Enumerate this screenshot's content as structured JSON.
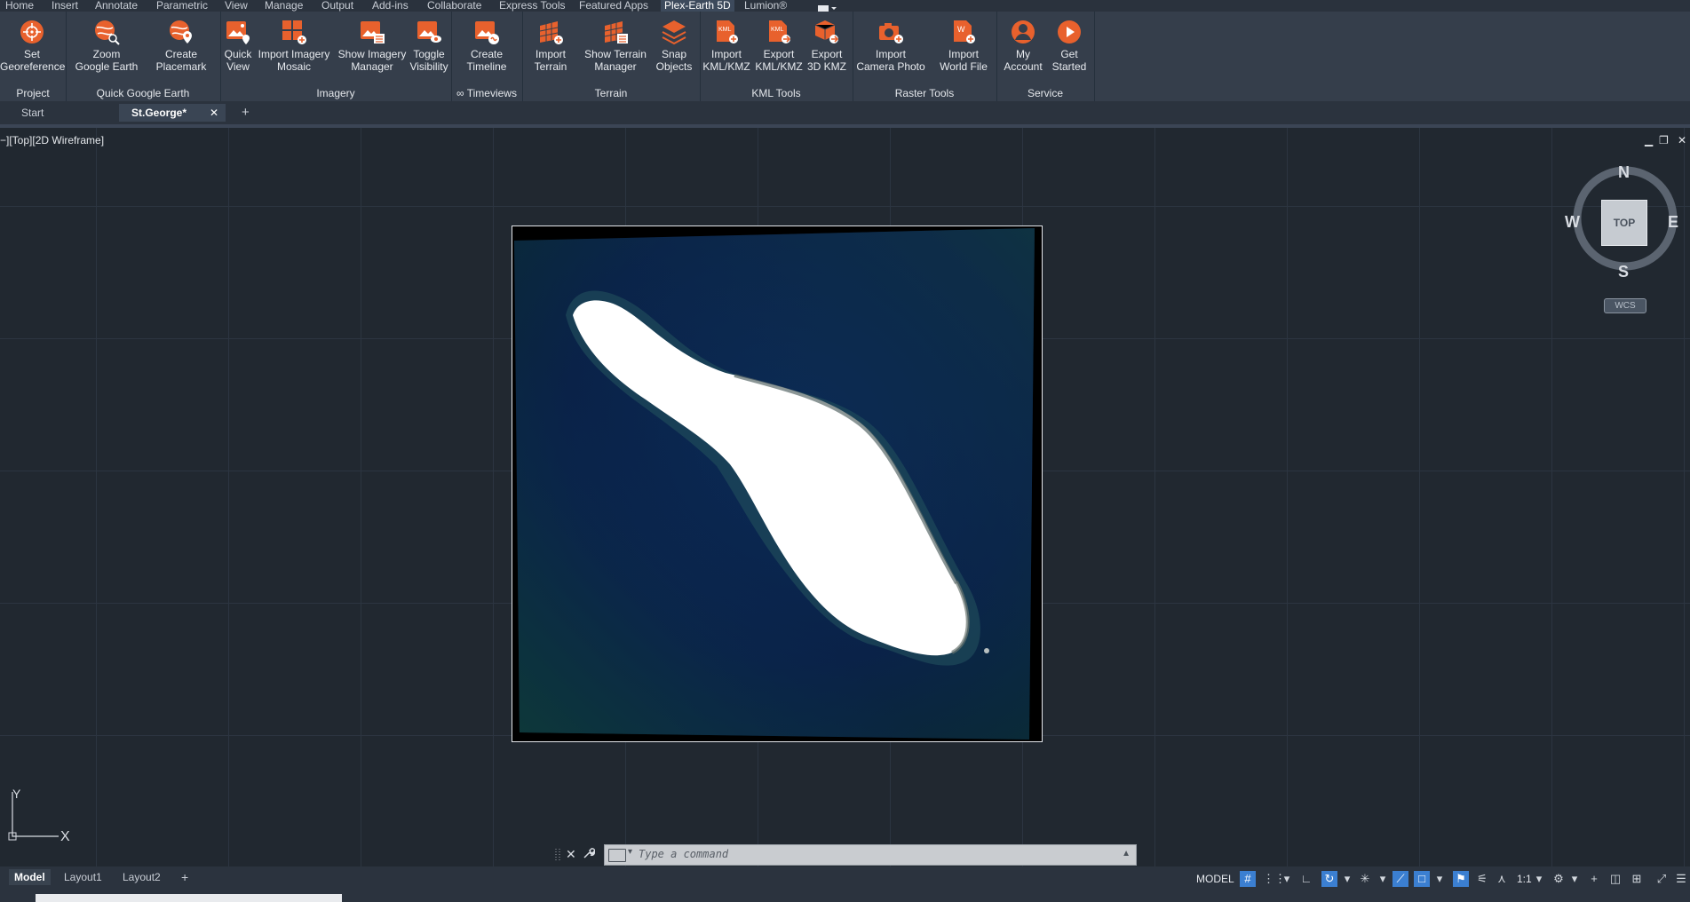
{
  "ribbon_tabs": [
    "Home",
    "Insert",
    "Annotate",
    "Parametric",
    "View",
    "Manage",
    "Output",
    "Add-ins",
    "Collaborate",
    "Express Tools",
    "Featured Apps",
    "Plex-Earth 5D",
    "Lumion®"
  ],
  "ribbon_groups": {
    "project": {
      "label": "Project",
      "buttons": [
        {
          "label": "Set\nGeoreference",
          "icon": "georeference-target-icon"
        }
      ]
    },
    "quick_google_earth": {
      "label": "Quick Google Earth",
      "buttons": [
        {
          "label": "Zoom\nGoogle Earth",
          "icon": "google-earth-zoom-icon"
        },
        {
          "label": "Create\nPlacemark",
          "icon": "placemark-icon"
        }
      ]
    },
    "imagery": {
      "label": "Imagery",
      "buttons": [
        {
          "label": "Quick\nView",
          "icon": "quick-view-image-icon"
        },
        {
          "label": "Import Imagery\nMosaic",
          "icon": "imagery-mosaic-icon"
        },
        {
          "label": "Show Imagery\nManager",
          "icon": "imagery-manager-icon"
        },
        {
          "label": "Toggle\nVisibility",
          "icon": "visibility-eye-icon"
        }
      ]
    },
    "timeviews": {
      "label": "∞ Timeviews",
      "buttons": [
        {
          "label": "Create\nTimeline",
          "icon": "timeline-icon"
        }
      ]
    },
    "terrain": {
      "label": "Terrain",
      "buttons": [
        {
          "label": "Import\nTerrain",
          "icon": "terrain-grid-icon"
        },
        {
          "label": "Show Terrain\nManager",
          "icon": "terrain-manager-icon"
        },
        {
          "label": "Snap\nObjects",
          "icon": "snap-objects-icon"
        }
      ]
    },
    "kml_tools": {
      "label": "KML Tools",
      "buttons": [
        {
          "label": "Import\nKML/KMZ",
          "icon": "kml-import-icon"
        },
        {
          "label": "Export\nKML/KMZ",
          "icon": "kml-export-icon"
        },
        {
          "label": "Export\n3D KMZ",
          "icon": "3d-kmz-export-icon"
        }
      ]
    },
    "raster_tools": {
      "label": "Raster Tools",
      "buttons": [
        {
          "label": "Import\nCamera Photo",
          "icon": "camera-photo-icon"
        },
        {
          "label": "Import\nWorld File",
          "icon": "world-file-icon"
        }
      ]
    },
    "service": {
      "label": "Service",
      "buttons": [
        {
          "label": "My\nAccount",
          "icon": "user-account-icon"
        },
        {
          "label": "Get\nStarted",
          "icon": "play-icon"
        }
      ]
    }
  },
  "doc_tabs": {
    "start": "Start",
    "active": "St.George*",
    "close_glyph": "✕",
    "new_glyph": "+"
  },
  "viewport": {
    "label": "−][Top][2D Wireframe]",
    "window_controls": [
      "▁",
      "❐",
      "✕"
    ],
    "compass": {
      "n": "N",
      "s": "S",
      "e": "E",
      "w": "W",
      "cube": "TOP"
    },
    "wcs": "WCS",
    "ucs": {
      "x": "X",
      "y": "Y"
    }
  },
  "command_line": {
    "placeholder": "Type a command",
    "close_glyph": "✕",
    "wrench_glyph": "🔧"
  },
  "layout_tabs": [
    "Model",
    "Layout1",
    "Layout2"
  ],
  "layout_add": "+",
  "status_bar": {
    "model_label": "MODEL",
    "scale": "1:1"
  },
  "colors": {
    "accent": "#e8612d",
    "ribbon_bg": "#353e4b",
    "viewport_bg": "#212830",
    "status_on": "#3b7fd1"
  }
}
